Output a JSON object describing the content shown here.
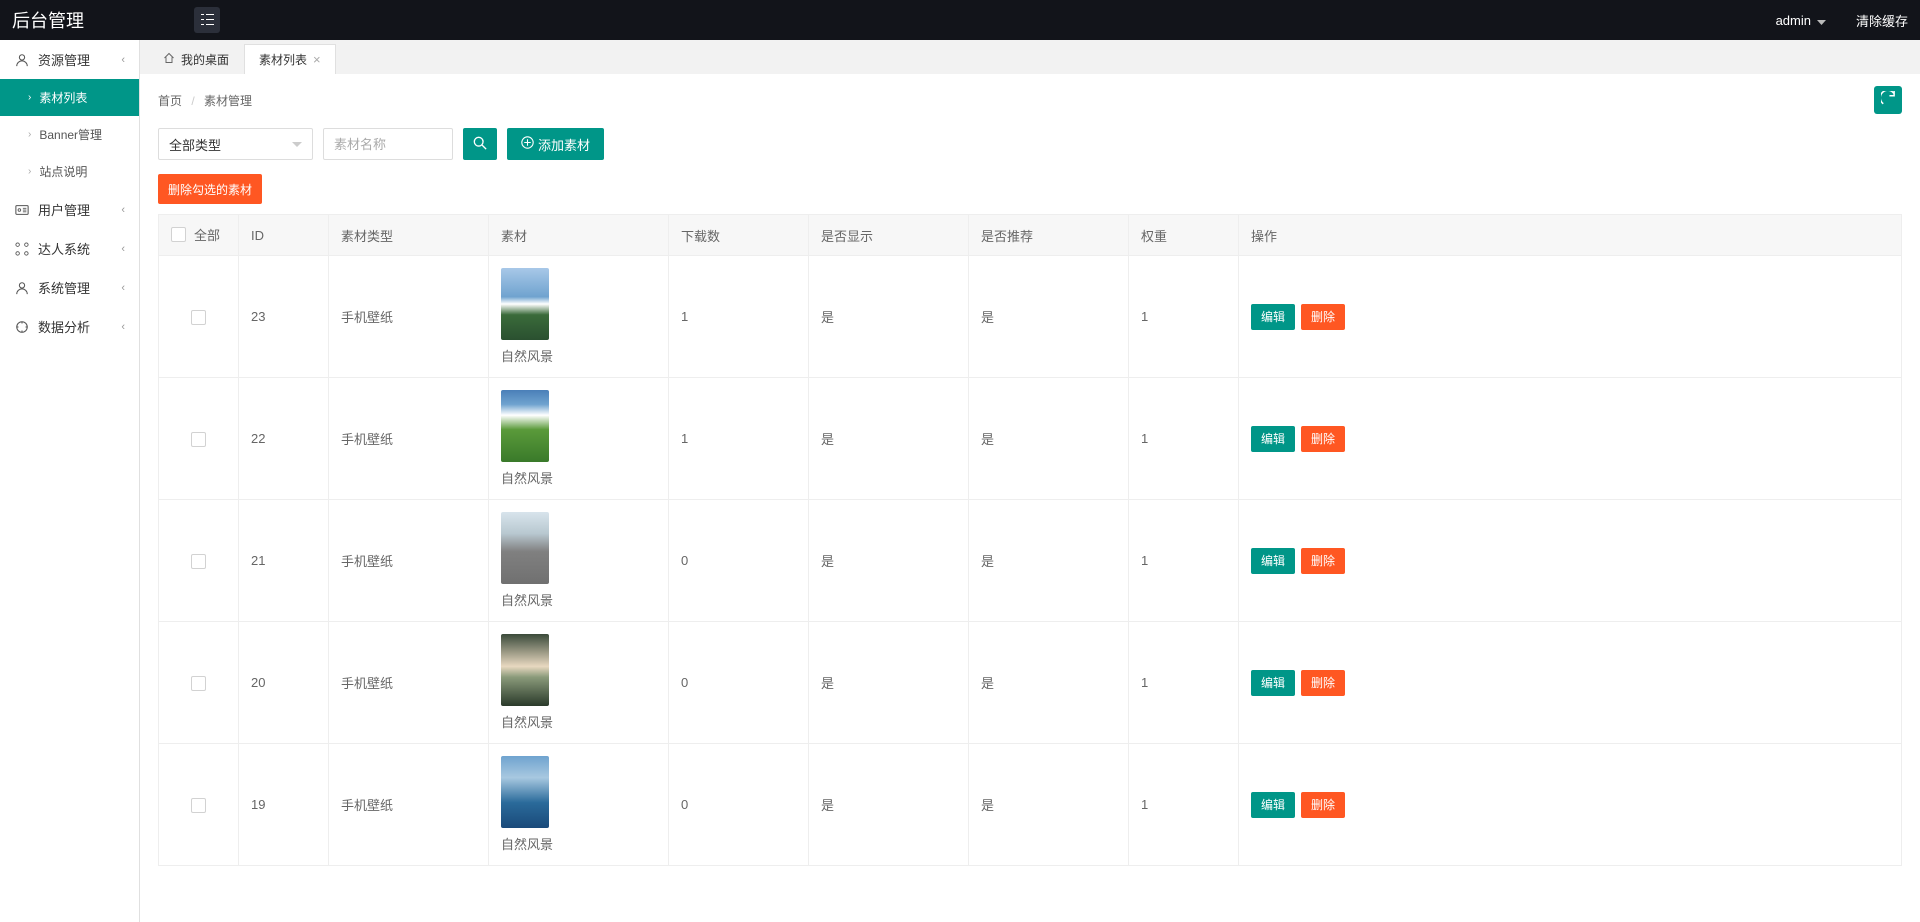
{
  "header": {
    "title": "后台管理",
    "user": "admin",
    "clear_cache": "清除缓存"
  },
  "sidebar": {
    "items": [
      {
        "name": "resource",
        "label": "资源管理",
        "icon": "user"
      },
      {
        "name": "user-mgmt",
        "label": "用户管理",
        "icon": "badge"
      },
      {
        "name": "master-sys",
        "label": "达人系统",
        "icon": "grid"
      },
      {
        "name": "sys-mgmt",
        "label": "系统管理",
        "icon": "user"
      },
      {
        "name": "data-analysis",
        "label": "数据分析",
        "icon": "target"
      }
    ],
    "resource_subitems": [
      {
        "name": "material-list",
        "label": "素材列表",
        "active": true
      },
      {
        "name": "banner-mgmt",
        "label": "Banner管理",
        "active": false
      },
      {
        "name": "site-desc",
        "label": "站点说明",
        "active": false
      }
    ]
  },
  "tabs": [
    {
      "name": "desktop",
      "label": "我的桌面",
      "icon": true,
      "closable": false,
      "active": false
    },
    {
      "name": "material-list",
      "label": "素材列表",
      "icon": false,
      "closable": true,
      "active": true
    }
  ],
  "breadcrumb": [
    "首页",
    "素材管理"
  ],
  "toolbar": {
    "type_select": "全部类型",
    "search_placeholder": "素材名称",
    "add_label": "添加素材",
    "delete_selected": "删除勾选的素材"
  },
  "table": {
    "headers": {
      "select_all": "全部",
      "id": "ID",
      "type": "素材类型",
      "material": "素材",
      "downloads": "下载数",
      "visible": "是否显示",
      "recommended": "是否推荐",
      "weight": "权重",
      "actions": "操作"
    },
    "actions": {
      "edit": "编辑",
      "delete": "删除"
    },
    "rows": [
      {
        "id": "23",
        "type": "手机壁纸",
        "title": "自然风景",
        "thumb": "mountain",
        "downloads": "1",
        "visible": "是",
        "recommended": "是",
        "weight": "1"
      },
      {
        "id": "22",
        "type": "手机壁纸",
        "title": "自然风景",
        "thumb": "grass",
        "downloads": "1",
        "visible": "是",
        "recommended": "是",
        "weight": "1"
      },
      {
        "id": "21",
        "type": "手机壁纸",
        "title": "自然风景",
        "thumb": "road",
        "downloads": "0",
        "visible": "是",
        "recommended": "是",
        "weight": "1"
      },
      {
        "id": "20",
        "type": "手机壁纸",
        "title": "自然风景",
        "thumb": "waterfall",
        "downloads": "0",
        "visible": "是",
        "recommended": "是",
        "weight": "1"
      },
      {
        "id": "19",
        "type": "手机壁纸",
        "title": "自然风景",
        "thumb": "lake",
        "downloads": "0",
        "visible": "是",
        "recommended": "是",
        "weight": "1"
      }
    ]
  },
  "thumbs": {
    "mountain": "linear-gradient(180deg,#a8c8e8 0%,#6fa3cf 40%,#fff 50%,#3a6b3a 65%,#2a5030 100%)",
    "grass": "linear-gradient(180deg,#4a7fb8 0%,#6fa3cf 20%,#ffffff 35%,#5a9a3a 55%,#3a7a2a 100%)",
    "road": "linear-gradient(180deg,#d8e4ec 0%,#b8c8d0 30%,#808080 55%,#707070 100%)",
    "waterfall": "linear-gradient(180deg,#3a4a3a 0%,#e8d8c0 45%,#8a9a7a 60%,#2a3a2a 100%)",
    "lake": "linear-gradient(180deg,#6fa3cf 0%,#a8c8e0 30%,#2a6a9a 65%,#1a4a7a 100%)"
  }
}
